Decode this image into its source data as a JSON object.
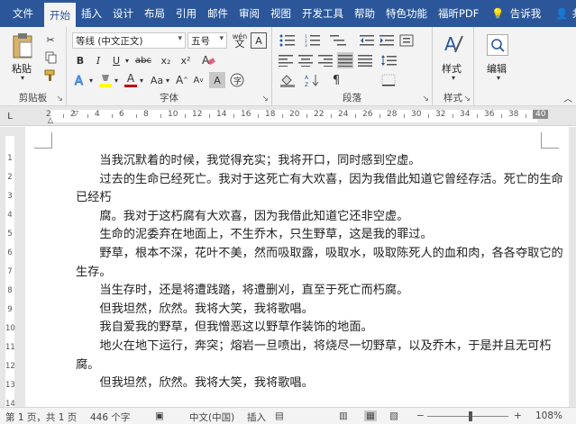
{
  "tabs": {
    "file": "文件",
    "home": "开始",
    "insert": "插入",
    "design": "设计",
    "layout": "布局",
    "references": "引用",
    "mailings": "邮件",
    "review": "审阅",
    "view": "视图",
    "developer": "开发工具",
    "help": "帮助",
    "special": "特色功能",
    "foxit": "福昕PDF",
    "tell_me": "告诉我",
    "share": "共享"
  },
  "ribbon": {
    "paste_label": "粘贴",
    "clipboard_label": "剪贴板",
    "font_name": "等线 (中文正文)",
    "font_size": "五号",
    "font_group_label": "字体",
    "paragraph_group_label": "段落",
    "styles_label": "样式",
    "styles_group_label": "样式",
    "edit_label": "编辑",
    "bold": "B",
    "italic": "I",
    "underline": "U",
    "strikethrough": "abc",
    "subscript": "x₂",
    "superscript": "x²",
    "font_color": "A",
    "char_shading": "A",
    "grow_font": "A",
    "shrink_font": "A",
    "change_case": "Aa",
    "phonetic": "wén",
    "border_char": "A"
  },
  "ruler": {
    "left_num": "L",
    "ticks": [
      "2",
      "2",
      "4",
      "6",
      "8",
      "10",
      "12",
      "14",
      "16",
      "18",
      "20",
      "22",
      "24",
      "26",
      "28",
      "30",
      "32",
      "34",
      "36",
      "38",
      "40"
    ]
  },
  "vruler_nums": [
    "1",
    "2",
    "3",
    "4",
    "5",
    "6",
    "7",
    "8",
    "9",
    "10",
    "11",
    "12",
    "13",
    "14"
  ],
  "document": {
    "paragraphs": [
      "当我沉默着的时候，我觉得充实；我将开口，同时感到空虚。",
      "过去的生命已经死亡。我对于这死亡有大欢喜，因为我借此知道它曾经存活。死亡的生命已经朽",
      "腐。我对于这朽腐有大欢喜，因为我借此知道它还非空虚。",
      "生命的泥委弃在地面上，不生乔木，只生野草，这是我的罪过。",
      "野草，根本不深，花叶不美，然而吸取露，吸取水，吸取陈死人的血和肉，各各夺取它的生存。",
      "当生存时，还是将遭践踏，将遭删刈，直至于死亡而朽腐。",
      "但我坦然，欣然。我将大笑，我将歌唱。",
      "我自爱我的野草，但我憎恶这以野草作装饰的地面。",
      "地火在地下运行，奔突；熔岩一旦喷出，将烧尽一切野草，以及乔木，于是并且无可朽腐。",
      "但我坦然，欣然。我将大笑，我将歌唱。"
    ]
  },
  "status": {
    "page": "第 1 页，共 1 页",
    "words": "446 个字",
    "language": "中文(中国)",
    "mode": "插入",
    "zoom": "108%",
    "zoom_minus": "−",
    "zoom_plus": "+"
  },
  "colors": {
    "tabbar_bg": "#2b579a",
    "font_color_bar": "#c00000",
    "highlight_bar": "#ffff00"
  }
}
